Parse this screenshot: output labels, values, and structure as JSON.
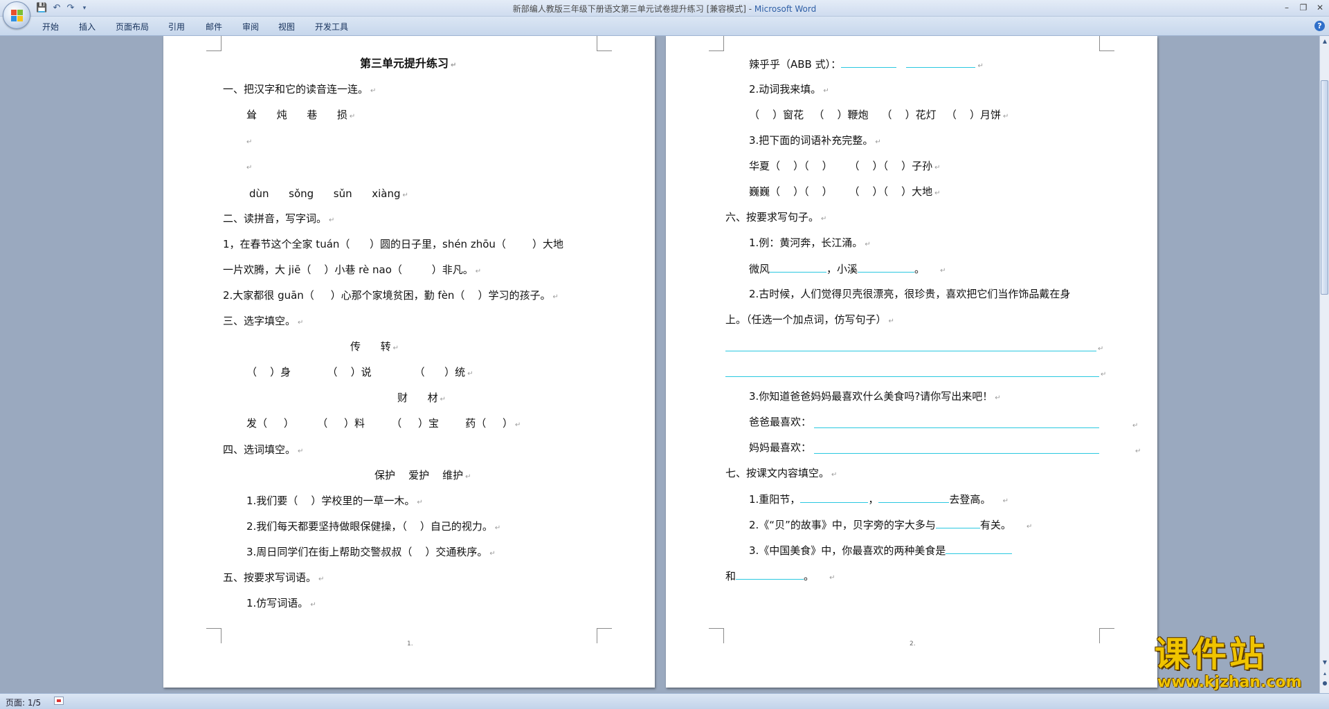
{
  "window": {
    "title": "新部编人教版三年级下册语文第三单元试卷提升练习 [兼容模式] - ",
    "app_name": "Microsoft Word",
    "quick_access": [
      "save-icon",
      "undo-icon",
      "redo-icon",
      "customize-icon"
    ]
  },
  "ribbon": {
    "tabs": [
      "开始",
      "插入",
      "页面布局",
      "引用",
      "邮件",
      "审阅",
      "视图",
      "开发工具"
    ]
  },
  "page1": {
    "title": "第三单元提升练习",
    "s1": "一、把汉字和它的读音连一连。",
    "s1_chars": "耸      炖      巷      损",
    "s1_pinyin": "dùn      sǒng      sǔn      xiàng",
    "s2": "二、读拼音，写字词。",
    "s2_l1": "1，在春节这个全家 tuán（      ）圆的日子里，shén zhōu（        ）大地",
    "s2_l2": "一片欢腾，大 jiē（    ）小巷 rè nao（         ）非凡。",
    "s2_l3": "2.大家都很 guān（     ）心那个家境贫困，勤 fèn（    ）学习的孩子。",
    "s3": "三、选字填空。",
    "s3_pair1": "传      转",
    "s3_l1": "（    ）身           （    ）说             （      ）统",
    "s3_pair2": "财      材",
    "s3_l2": "发（     ）       （     ）料        （     ）宝        药（     ）",
    "s4": "四、选词填空。",
    "s4_words": "保护    爱护    维护",
    "s4_l1": "1.我们要（    ）学校里的一草一木。",
    "s4_l2": "2.我们每天都要坚持做眼保健操，（    ）自己的视力。",
    "s4_l3": "3.周日同学们在街上帮助交警叔叔（    ）交通秩序。",
    "s5": "五、按要求写词语。",
    "s5_l1": "1.仿写词语。",
    "page_number": "1."
  },
  "page2": {
    "l1": "辣乎乎（ABB 式）：",
    "l2": "2.动词我来填。",
    "l3": "（    ）窗花   （    ）鞭炮    （    ）花灯   （    ）月饼",
    "l4": "3.把下面的词语补充完整。",
    "l5": "华夏（    ）（    ）     （    ）（    ）子孙",
    "l6": "巍巍（    ）（    ）     （    ）（    ）大地",
    "s6": "六、按要求写句子。",
    "l7": "1.例：黄河奔，长江涌。",
    "l8a": "微风",
    "l8b": "，小溪",
    "l8c": "。",
    "l9": "2.古时候，人们觉得贝壳很漂亮，很珍贵，喜欢把它们当作饰品戴在身",
    "l10": "上。（任选一个加点词，仿写句子）",
    "l11": "3.你知道爸爸妈妈最喜欢什么美食吗?请你写出来吧！",
    "l12": "爸爸最喜欢：",
    "l13": "妈妈最喜欢：",
    "s7": "七、按课文内容填空。",
    "l14a": "1.重阳节，",
    "l14b": "，",
    "l14c": "去登高。",
    "l15a": "2.《“贝”的故事》中，贝字旁的字大多与",
    "l15b": "有关。",
    "l16": "3.《中国美食》中，你最喜欢的两种美食是",
    "l17a": "和",
    "l17b": "。",
    "page_number": "2."
  },
  "status": {
    "page": "页面: 1/5"
  },
  "watermark": {
    "line1": "课件站",
    "line2": "www.kjzhan.com"
  },
  "colors": {
    "underline": "#29c8e0",
    "app_bg": "#9aa9bf",
    "watermark": "#f0c400"
  }
}
